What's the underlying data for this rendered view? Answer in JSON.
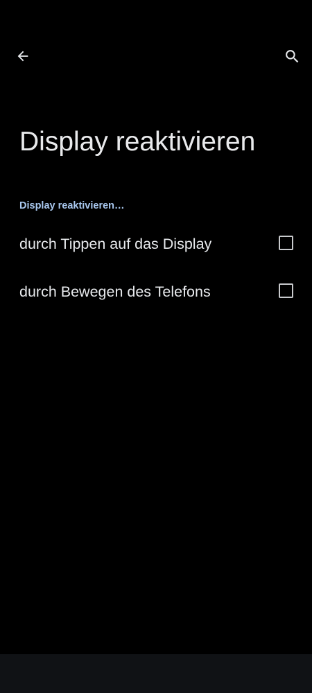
{
  "app_bar": {
    "back_icon": "arrow-back-icon",
    "search_icon": "search-icon"
  },
  "page": {
    "title": "Display reaktivieren"
  },
  "section": {
    "header": "Display reaktivieren…"
  },
  "options": [
    {
      "label": "durch Tippen auf das Display",
      "checked": false
    },
    {
      "label": "durch Bewegen des Telefons",
      "checked": false
    }
  ],
  "colors": {
    "background": "#000000",
    "title_text": "#e9eaec",
    "section_header": "#a9c8ef",
    "checkbox_border": "#c8cacd",
    "nav_bar": "#101215"
  }
}
